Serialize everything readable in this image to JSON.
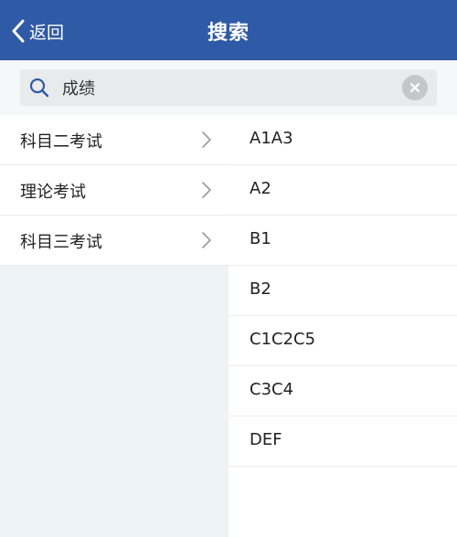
{
  "header": {
    "back_label": "返回",
    "title": "搜索"
  },
  "search": {
    "value": "成绩"
  },
  "categories": [
    {
      "label": "科目二考试"
    },
    {
      "label": "理论考试"
    },
    {
      "label": "科目三考试"
    }
  ],
  "results": [
    {
      "label": "A1A3"
    },
    {
      "label": "A2"
    },
    {
      "label": "B1"
    },
    {
      "label": "B2"
    },
    {
      "label": "C1C2C5"
    },
    {
      "label": "C3C4"
    },
    {
      "label": "DEF"
    }
  ],
  "colors": {
    "header_bg": "#2f5aa6",
    "page_bg": "#eef3f7",
    "text": "#222222"
  },
  "icons": {
    "back": "chevron-left-icon",
    "search": "search-icon",
    "clear": "clear-icon",
    "row_arrow": "chevron-right-icon"
  }
}
